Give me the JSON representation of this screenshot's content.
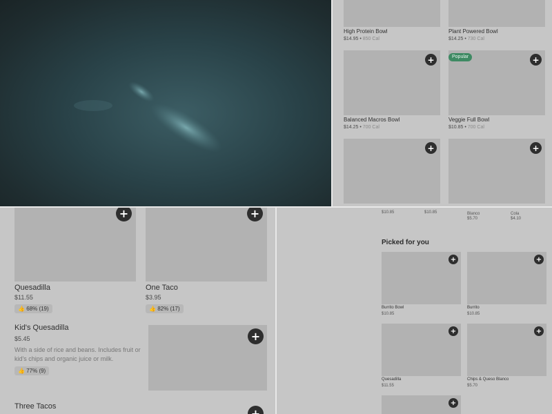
{
  "colors": {
    "badge": "#3e8a63",
    "add_button": "#2e2e2e",
    "card_image": "#b2b2b2",
    "background": "#c6c6c6"
  },
  "icons": {
    "add": "plus-icon",
    "rating": "thumbs-up-icon",
    "video": "fish-video"
  },
  "top_right": {
    "items": [
      {
        "name": "High Protein Bowl",
        "price": "$14.95",
        "cal": "850 Cal"
      },
      {
        "name": "Plant Powered Bowl",
        "price": "$14.25",
        "cal": "730 Cal"
      },
      {
        "name": "Balanced Macros Bowl",
        "price": "$14.25",
        "cal": "700 Cal"
      },
      {
        "name": "Veggie Full Bowl",
        "price": "$10.85",
        "cal": "700 Cal",
        "badge": "Popular"
      }
    ]
  },
  "bottom_left": {
    "items": [
      {
        "name": "Quesadilla",
        "price": "$11.55",
        "rating": "68% (19)"
      },
      {
        "name": "One Taco",
        "price": "$3.95",
        "rating": "82% (17)"
      },
      {
        "name": "Kid's Quesadilla",
        "price": "$5.45",
        "desc": "With a side of rice and beans. Includes fruit or kid's chips and organic juice or milk.",
        "rating": "77% (9)"
      },
      {
        "name": "Three Tacos"
      }
    ]
  },
  "bottom_right": {
    "top_prices": [
      "$10.85",
      "$10.85",
      "$5.70",
      "$4.10"
    ],
    "top_names": [
      "Blanco",
      "Cola"
    ],
    "section_title": "Picked for you",
    "items": [
      {
        "name": "Burrito Bowl",
        "price": "$10.85"
      },
      {
        "name": "Burrito",
        "price": "$10.85"
      },
      {
        "name": "Quesadilla",
        "price": "$11.55"
      },
      {
        "name": "Chips & Queso Blanco",
        "price": "$5.70"
      }
    ]
  }
}
